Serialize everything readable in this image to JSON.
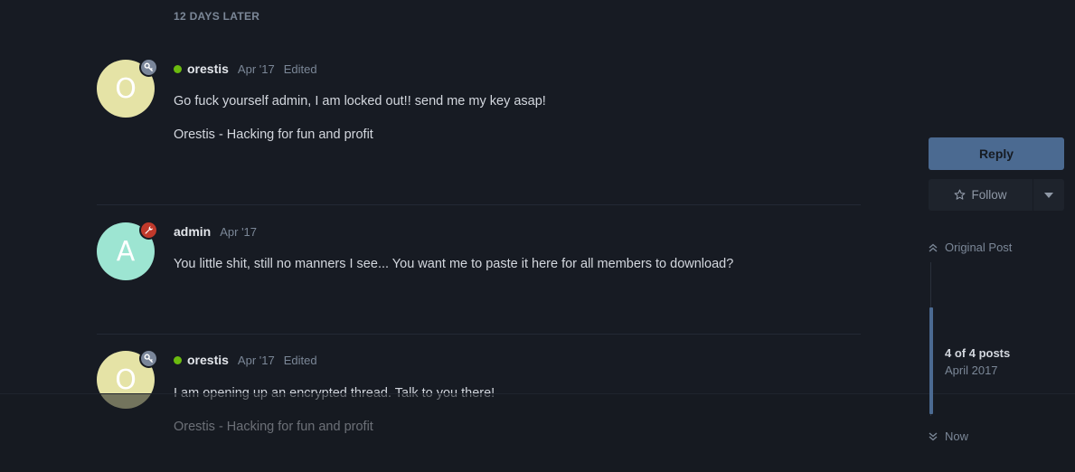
{
  "time_gap": "12 DAYS LATER",
  "posts": [
    {
      "avatar_letter": "O",
      "avatar_color": "#e5e3a6",
      "badge_icon": "key-icon",
      "badge_color": "#7a869a",
      "online": true,
      "username": "orestis",
      "date": "Apr '17",
      "edited": "Edited",
      "lines": [
        "Go fuck yourself admin, I am locked out!! send me my key asap!",
        "Orestis - Hacking for fun and profit"
      ]
    },
    {
      "avatar_letter": "A",
      "avatar_color": "#9de5d2",
      "badge_icon": "wrench-icon",
      "badge_color": "#c0392b",
      "online": false,
      "username": "admin",
      "date": "Apr '17",
      "edited": "",
      "lines": [
        "You little shit, still no manners I see... You want me to paste it here for all members to download?"
      ]
    },
    {
      "avatar_letter": "O",
      "avatar_color": "#e5e3a6",
      "badge_icon": "key-icon",
      "badge_color": "#7a869a",
      "online": true,
      "username": "orestis",
      "date": "Apr '17",
      "edited": "Edited",
      "lines": [
        "I am opening up an encrypted thread. Talk to you there!",
        "Orestis - Hacking for fun and profit"
      ]
    }
  ],
  "sidebar": {
    "reply_label": "Reply",
    "follow_label": "Follow",
    "original_post_label": "Original Post",
    "position_label": "4 of 4 posts",
    "position_date": "April 2017",
    "now_label": "Now"
  },
  "colors": {
    "background": "#171b23",
    "accent": "#4b6a91",
    "online": "#6cbb0f"
  }
}
